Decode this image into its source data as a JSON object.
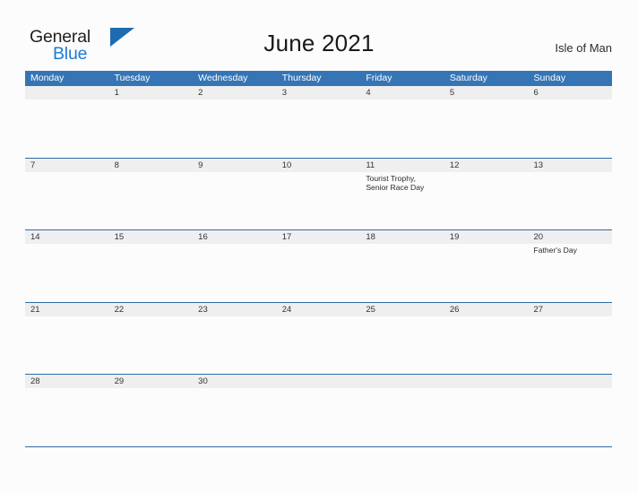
{
  "header": {
    "logo": {
      "word_top": "General",
      "word_bottom": "Blue",
      "flag_color": "#1d6bb0",
      "blue_text_color": "#1c7cd6"
    },
    "title": "June 2021",
    "location": "Isle of Man"
  },
  "calendar": {
    "accent_color": "#3575b5",
    "rule_color": "#2e6ca4",
    "band_color": "#efefef",
    "day_names": [
      "Monday",
      "Tuesday",
      "Wednesday",
      "Thursday",
      "Friday",
      "Saturday",
      "Sunday"
    ],
    "weeks": [
      [
        {
          "num": "",
          "events": []
        },
        {
          "num": "1",
          "events": []
        },
        {
          "num": "2",
          "events": []
        },
        {
          "num": "3",
          "events": []
        },
        {
          "num": "4",
          "events": []
        },
        {
          "num": "5",
          "events": []
        },
        {
          "num": "6",
          "events": []
        }
      ],
      [
        {
          "num": "7",
          "events": []
        },
        {
          "num": "8",
          "events": []
        },
        {
          "num": "9",
          "events": []
        },
        {
          "num": "10",
          "events": []
        },
        {
          "num": "11",
          "events": [
            "Tourist Trophy,",
            "Senior Race Day"
          ]
        },
        {
          "num": "12",
          "events": []
        },
        {
          "num": "13",
          "events": []
        }
      ],
      [
        {
          "num": "14",
          "events": []
        },
        {
          "num": "15",
          "events": []
        },
        {
          "num": "16",
          "events": []
        },
        {
          "num": "17",
          "events": []
        },
        {
          "num": "18",
          "events": []
        },
        {
          "num": "19",
          "events": []
        },
        {
          "num": "20",
          "events": [
            "Father's Day"
          ]
        }
      ],
      [
        {
          "num": "21",
          "events": []
        },
        {
          "num": "22",
          "events": []
        },
        {
          "num": "23",
          "events": []
        },
        {
          "num": "24",
          "events": []
        },
        {
          "num": "25",
          "events": []
        },
        {
          "num": "26",
          "events": []
        },
        {
          "num": "27",
          "events": []
        }
      ],
      [
        {
          "num": "28",
          "events": []
        },
        {
          "num": "29",
          "events": []
        },
        {
          "num": "30",
          "events": []
        },
        {
          "num": "",
          "events": []
        },
        {
          "num": "",
          "events": []
        },
        {
          "num": "",
          "events": []
        },
        {
          "num": "",
          "events": []
        }
      ]
    ]
  }
}
